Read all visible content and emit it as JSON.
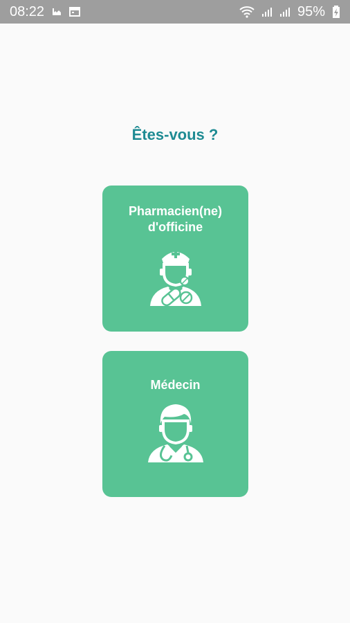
{
  "status_bar": {
    "time": "08:22",
    "battery": "95%",
    "icons": [
      "gallery-icon",
      "calendar-icon",
      "wifi-icon",
      "signal-icon",
      "signal-icon",
      "battery-charging-icon"
    ]
  },
  "page": {
    "title": "Êtes-vous ?"
  },
  "options": [
    {
      "label_line1": "Pharmacien(ne)",
      "label_line2": "d'officine",
      "icon": "pharmacist-icon"
    },
    {
      "label_line1": "Médecin",
      "icon": "doctor-icon"
    }
  ],
  "colors": {
    "accent_title": "#1e8b93",
    "card_bg": "#58c394",
    "status_bar_bg": "#9e9e9e",
    "page_bg": "#fafafa"
  }
}
